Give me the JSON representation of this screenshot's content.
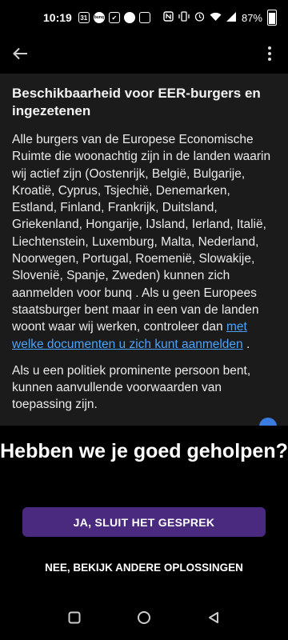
{
  "status_bar": {
    "time": "10:19",
    "notif_icons": [
      "31",
      "bunq",
      "✔",
      "🤖",
      "🚌"
    ],
    "battery": "87%"
  },
  "toolbar": {
    "back_icon": "arrow-left-icon",
    "menu_icon": "more-vert-icon"
  },
  "article": {
    "title": "Beschikbaarheid voor EER-burgers en ingezetenen",
    "p1_text": "Alle burgers van de Europese Economische Ruimte die woonachtig zijn in de landen waarin wij actief zijn (Oostenrijk, België, Bulgarije, Kroatië, Cyprus, Tsjechië, Denemarken, Estland, Finland, Frankrijk, Duitsland, Griekenland, Hongarije, IJsland, Ierland, Italië, Liechtenstein, Luxemburg, Malta, Nederland, Noorwegen, Portugal, Roemenië, Slowakije, Slovenië, Spanje, Zweden) kunnen zich aanmelden voor bunq . Als u geen Europees staatsburger bent maar in een van de landen woont waar wij werken, controleer dan ",
    "p1_link": "met welke documenten u zich kunt aanmelden",
    "p1_end": " .",
    "p2_text": "Als u een politiek prominente persoon bent, kunnen aanvullende voorwaarden van toepassing zijn."
  },
  "feedback": {
    "title": "Hebben we je goed geholpen?",
    "yes_label": "JA, SLUIT HET GESPREK",
    "no_label": "NEE, BEKIJK ANDERE OPLOSSINGEN"
  },
  "colors": {
    "accent": "#4a2a7e",
    "link": "#4aa3ff",
    "card_bg": "#1b1b1b"
  }
}
